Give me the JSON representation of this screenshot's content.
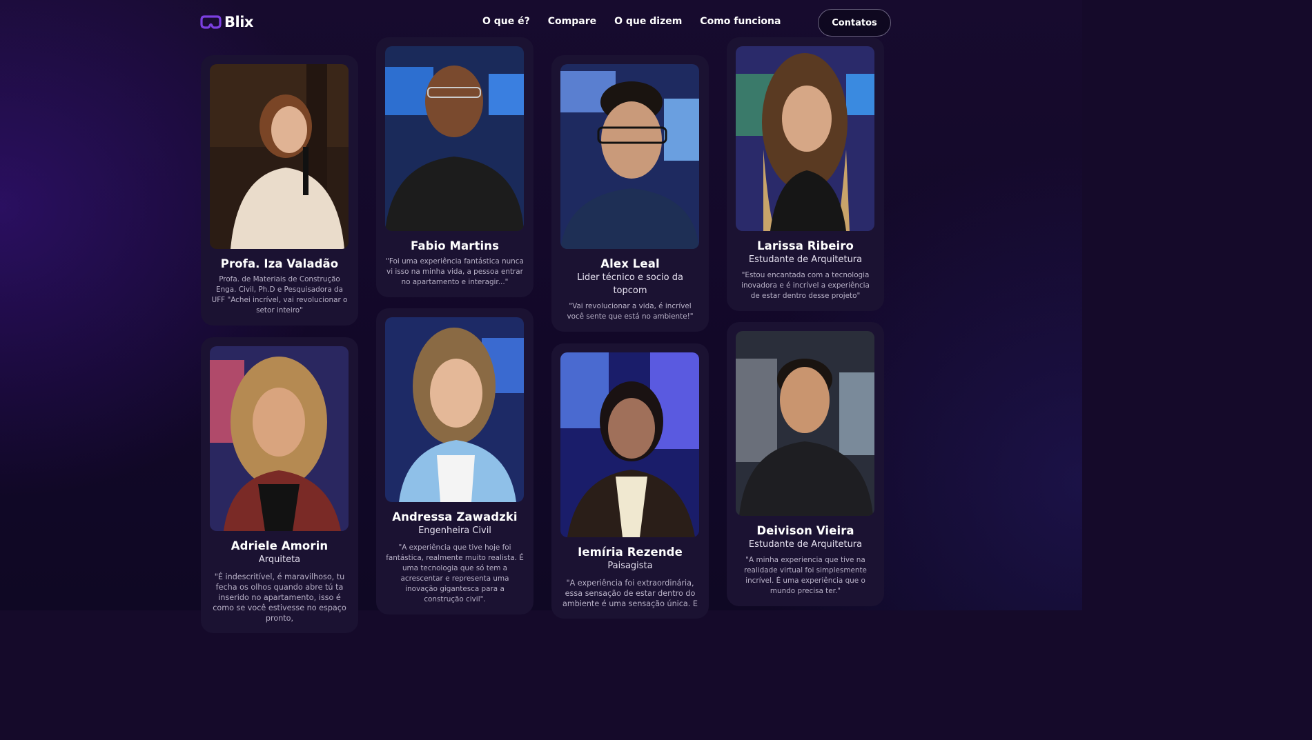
{
  "brand": {
    "name": "Blix",
    "logo_icon": "vr-headset-icon"
  },
  "nav": {
    "links": [
      "O que é?",
      "Compare",
      "O que dizem",
      "Como funciona"
    ],
    "contact_label": "Contatos"
  },
  "testimonials": [
    {
      "name": "Profa. Iza Valadão",
      "role": "",
      "quote": "Profa. de Materiais de Construção Enga. Civil, Ph.D e Pesquisadora da UFF \"Achei incrível, vai revolucionar o setor inteiro\""
    },
    {
      "name": "Fabio Martins",
      "role": "",
      "quote": "\"Foi uma experiência fantástica nunca vi isso na minha vida, a pessoa entrar no apartamento e interagir...\""
    },
    {
      "name": "Alex Leal",
      "role": "Lider técnico e socio da topcom",
      "quote": "\"Vai revolucionar a vida, é incrível você sente que está no ambiente!\""
    },
    {
      "name": "Larissa Ribeiro",
      "role": "Estudante de Arquitetura",
      "quote": "\"Estou encantada com a tecnologia inovadora e é incrível a experiência de estar dentro desse projeto\""
    },
    {
      "name": "Adriele Amorin",
      "role": "Arquiteta",
      "quote": "\"É indescritível, é maravilhoso, tu fecha os olhos quando abre tú ta inserido no apartamento, isso é como se você estivesse no espaço pronto,"
    },
    {
      "name": "Andressa Zawadzki",
      "role": "Engenheira Civil",
      "quote": "\"A experiência que tive hoje foi fantástica, realmente muito realista. É uma tecnologia que só tem a acrescentar e representa uma inovação gigantesca para a construção civil\"."
    },
    {
      "name": "Iemíria Rezende",
      "role": "Paisagista",
      "quote": "\"A experiência foi extraordinária, essa sensação de estar dentro do ambiente é uma sensação única. E"
    },
    {
      "name": "Deivison Vieira",
      "role": "Estudante de Arquitetura",
      "quote": "\"A minha experiencia que tive na realidade virtual foi simplesmente incrível. É uma experiência que o mundo precisa ter.\""
    }
  ]
}
